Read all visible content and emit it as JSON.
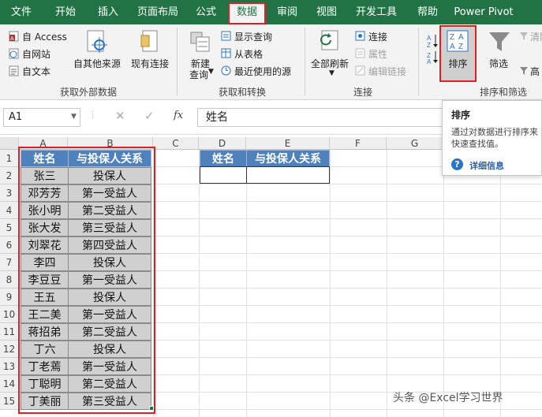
{
  "menu": {
    "tabs": [
      "文件",
      "开始",
      "插入",
      "页面布局",
      "公式",
      "数据",
      "审阅",
      "视图",
      "开发工具",
      "帮助",
      "Power Pivot"
    ],
    "active": "数据"
  },
  "ribbon": {
    "get_external": {
      "access": "自 Access",
      "web": "自网站",
      "text": "自文本",
      "other": "自其他来源",
      "existing": "现有连接",
      "label": "获取外部数据"
    },
    "transform": {
      "new_query": "新建",
      "new_query_2": "查询",
      "show_queries": "显示查询",
      "from_table": "从表格",
      "recent": "最近使用的源",
      "label": "获取和转换"
    },
    "connections": {
      "refresh_all": "全部刷新",
      "connections": "连接",
      "properties": "属性",
      "edit_links": "编辑链接",
      "label": "连接"
    },
    "sort_filter": {
      "sort": "排序",
      "filter": "筛选",
      "clear": "清除",
      "advanced": "高",
      "label": "排序和筛选"
    }
  },
  "formula_bar": {
    "name_box": "A1",
    "fx": "fx",
    "content": "姓名"
  },
  "columns": [
    "A",
    "B",
    "C",
    "D",
    "E",
    "F",
    "G"
  ],
  "rows": [
    "1",
    "2",
    "3",
    "4",
    "5",
    "6",
    "7",
    "8",
    "9",
    "10",
    "11",
    "12",
    "13",
    "14",
    "15"
  ],
  "table1": {
    "headers": [
      "姓名",
      "与投保人关系"
    ],
    "rows": [
      [
        "张三",
        "投保人"
      ],
      [
        "邓芳芳",
        "第一受益人"
      ],
      [
        "张小明",
        "第二受益人"
      ],
      [
        "张大发",
        "第三受益人"
      ],
      [
        "刘翠花",
        "第四受益人"
      ],
      [
        "李四",
        "投保人"
      ],
      [
        "李豆豆",
        "第一受益人"
      ],
      [
        "王五",
        "投保人"
      ],
      [
        "王二美",
        "第一受益人"
      ],
      [
        "蒋招弟",
        "第二受益人"
      ],
      [
        "丁六",
        "投保人"
      ],
      [
        "丁老蔫",
        "第一受益人"
      ],
      [
        "丁聪明",
        "第二受益人"
      ],
      [
        "丁美丽",
        "第三受益人"
      ]
    ]
  },
  "table2": {
    "headers": [
      "姓名",
      "与投保人关系"
    ]
  },
  "tooltip": {
    "title": "排序",
    "line1": "通过对数据进行排序来",
    "line2": "快速查找值。",
    "link": "详细信息"
  },
  "watermark": "头条 @Excel学习世界",
  "colors": {
    "excel_green": "#217346",
    "header_blue": "#4f81bd",
    "highlight_red": "#e02020"
  }
}
